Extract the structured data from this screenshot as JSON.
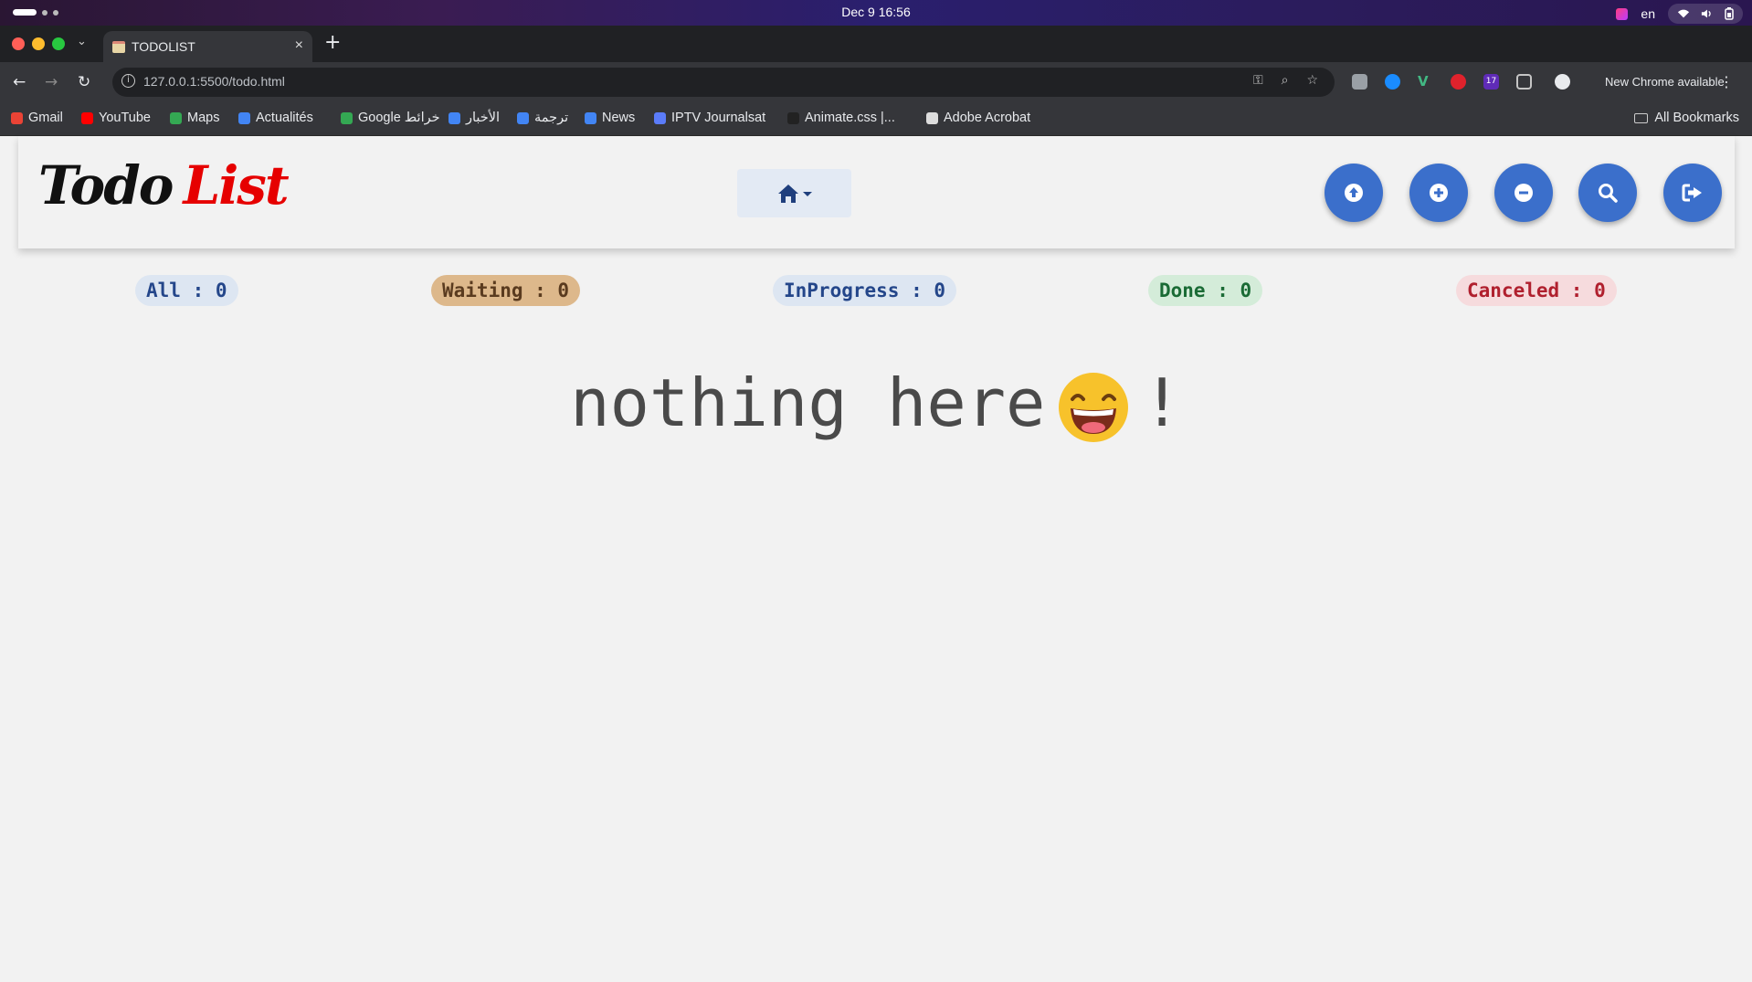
{
  "os": {
    "clock": "Dec 9  16:56",
    "lang": "en"
  },
  "browser": {
    "tab_title": "TODOLIST",
    "url": "127.0.0.1:5500/todo.html",
    "update_text": "New Chrome available",
    "ext_badge": "17",
    "bookmarks": [
      {
        "label": "Gmail",
        "color": "#ea4335"
      },
      {
        "label": "YouTube",
        "color": "#ff0000"
      },
      {
        "label": "Maps",
        "color": "#34a853"
      },
      {
        "label": "Actualités",
        "color": "#4285f4"
      },
      {
        "label": "Google خرائط",
        "color": "#34a853"
      },
      {
        "label": "الأخبار",
        "color": "#4285f4"
      },
      {
        "label": "ترجمة",
        "color": "#4285f4"
      },
      {
        "label": "News",
        "color": "#4285f4"
      },
      {
        "label": "IPTV Journalsat",
        "color": "#5b7cfa"
      },
      {
        "label": "Animate.css |...",
        "color": "#222222"
      },
      {
        "label": "Adobe Acrobat",
        "color": "#dddddd"
      }
    ],
    "all_bookmarks": "All Bookmarks"
  },
  "app": {
    "logo_todo": "Todo",
    "logo_list": "List",
    "home_icon": "home-icon",
    "actions": [
      {
        "name": "upload-button",
        "icon": "arrow-up-circle-icon"
      },
      {
        "name": "add-button",
        "icon": "plus-circle-icon"
      },
      {
        "name": "remove-button",
        "icon": "minus-circle-icon"
      },
      {
        "name": "search-button",
        "icon": "search-icon"
      },
      {
        "name": "logout-button",
        "icon": "sign-out-icon"
      }
    ],
    "filters": {
      "all": "All : 0",
      "waiting": "Waiting : 0",
      "inprogress": "InProgress : 0",
      "done": "Done : 0",
      "canceled": "Canceled : 0"
    },
    "empty_text": "nothing here",
    "empty_bang": "!",
    "colors": {
      "primary": "#3b6fcb",
      "logo_red": "#e60000"
    }
  }
}
